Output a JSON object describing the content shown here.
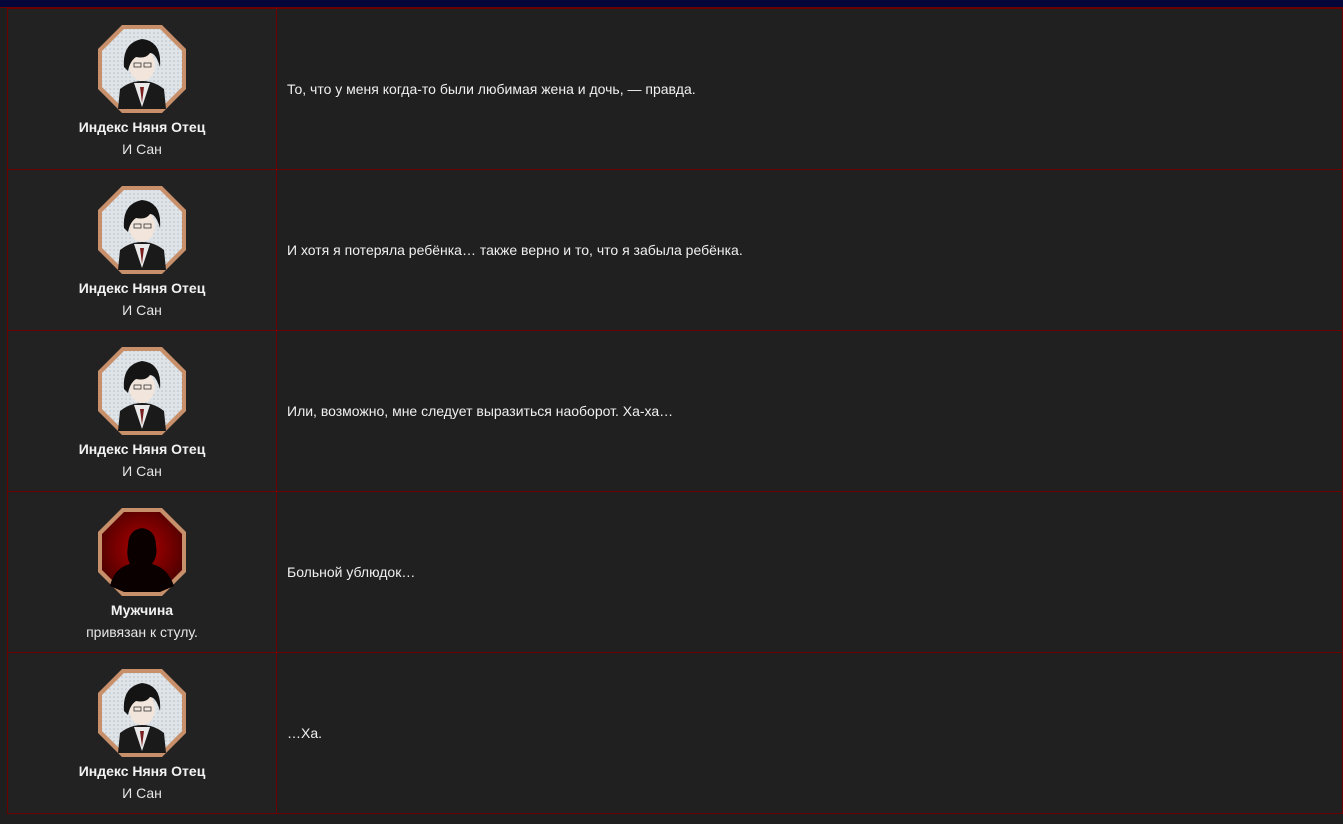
{
  "colors": {
    "top_bar": "#05063a",
    "border": "#6a0000",
    "background": "#1f1f1f",
    "avatar_frame": "#c8906a",
    "silhouette_bg": "#8a0000"
  },
  "rows": [
    {
      "speaker_name": "Индекс Няня Отец",
      "speaker_sub": "И Сан",
      "avatar_icon": "index-father-portrait-icon",
      "line": "То, что у меня когда-то были любимая жена и дочь, — правда."
    },
    {
      "speaker_name": "Индекс Няня Отец",
      "speaker_sub": "И Сан",
      "avatar_icon": "index-father-portrait-icon",
      "line": "И хотя я потеряла ребёнка… также верно и то, что я забыла ребёнка."
    },
    {
      "speaker_name": "Индекс Няня Отец",
      "speaker_sub": "И Сан",
      "avatar_icon": "index-father-portrait-icon",
      "line": "Или, возможно, мне следует выразиться наоборот. Ха-ха…"
    },
    {
      "speaker_name": "Мужчина",
      "speaker_sub": "привязан к стулу.",
      "avatar_icon": "silhouette-portrait-icon",
      "line": "Больной ублюдок…"
    },
    {
      "speaker_name": "Индекс Няня Отец",
      "speaker_sub": "И Сан",
      "avatar_icon": "index-father-portrait-icon",
      "line": "…Ха."
    }
  ]
}
